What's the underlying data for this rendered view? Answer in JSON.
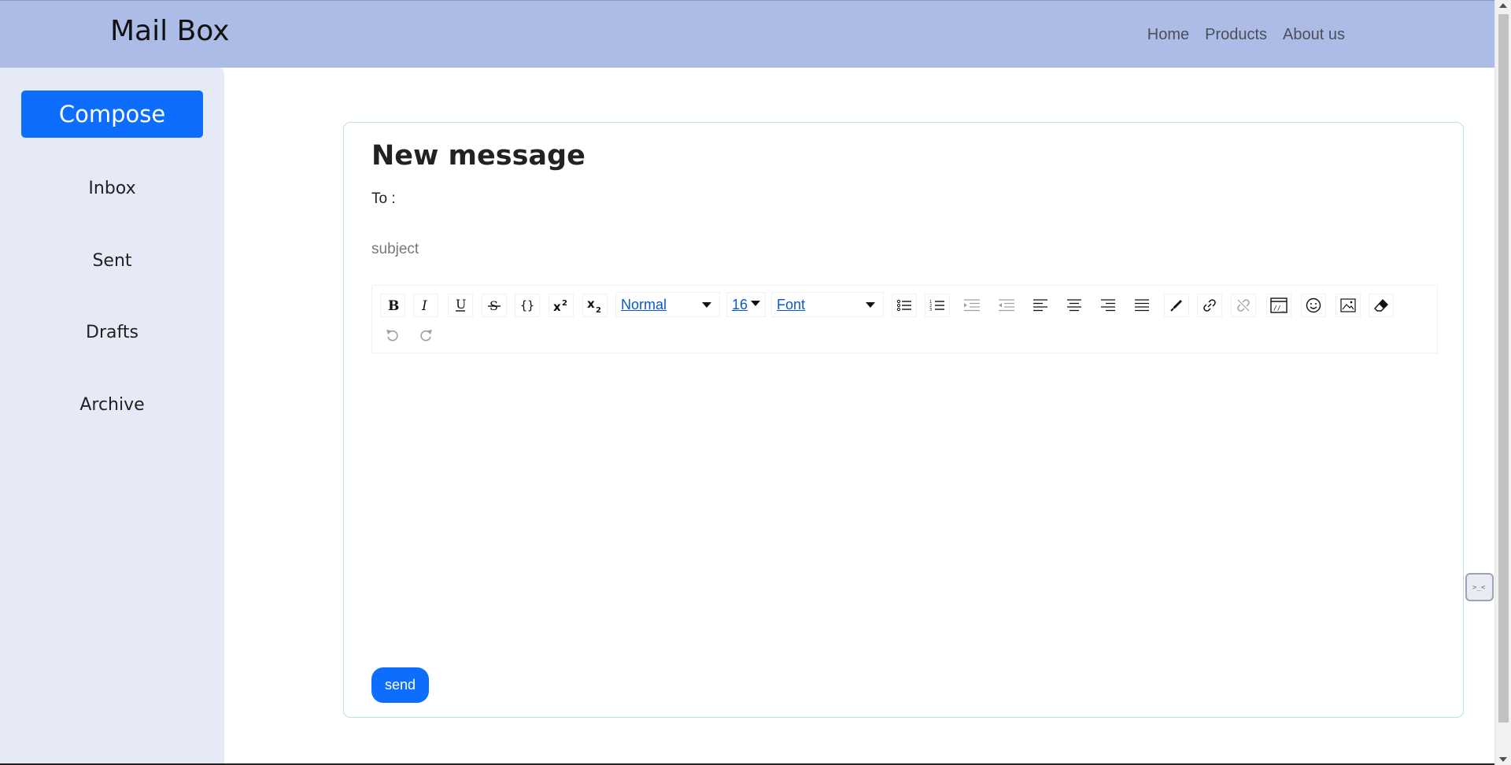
{
  "header": {
    "brand": "Mail Box",
    "nav": [
      "Home",
      "Products",
      "About us"
    ]
  },
  "sidebar": {
    "compose_label": "Compose",
    "items": [
      {
        "label": "Inbox"
      },
      {
        "label": "Sent"
      },
      {
        "label": "Drafts"
      },
      {
        "label": "Archive"
      }
    ]
  },
  "compose": {
    "title": "New message",
    "to_label": "To :",
    "to_value": "",
    "subject_placeholder": "subject",
    "subject_value": "",
    "send_label": "send"
  },
  "toolbar": {
    "block_type": "Normal",
    "font_size": "16",
    "font_family": "Font",
    "buttons": [
      "bold-icon",
      "italic-icon",
      "underline-icon",
      "strikethrough-icon",
      "code-icon",
      "superscript-icon",
      "subscript-icon",
      "unordered-list-icon",
      "ordered-list-icon",
      "indent-icon",
      "outdent-icon",
      "align-left-icon",
      "align-center-icon",
      "align-right-icon",
      "align-justify-icon",
      "color-picker-icon",
      "link-icon",
      "unlink-icon",
      "embed-icon",
      "emoji-icon",
      "image-icon",
      "eraser-icon",
      "undo-icon",
      "redo-icon"
    ]
  },
  "colors": {
    "header_bg": "#acbce6",
    "sidebar_bg": "#e6eaf7",
    "primary": "#0d6efd",
    "card_border": "#b9dfe8"
  }
}
